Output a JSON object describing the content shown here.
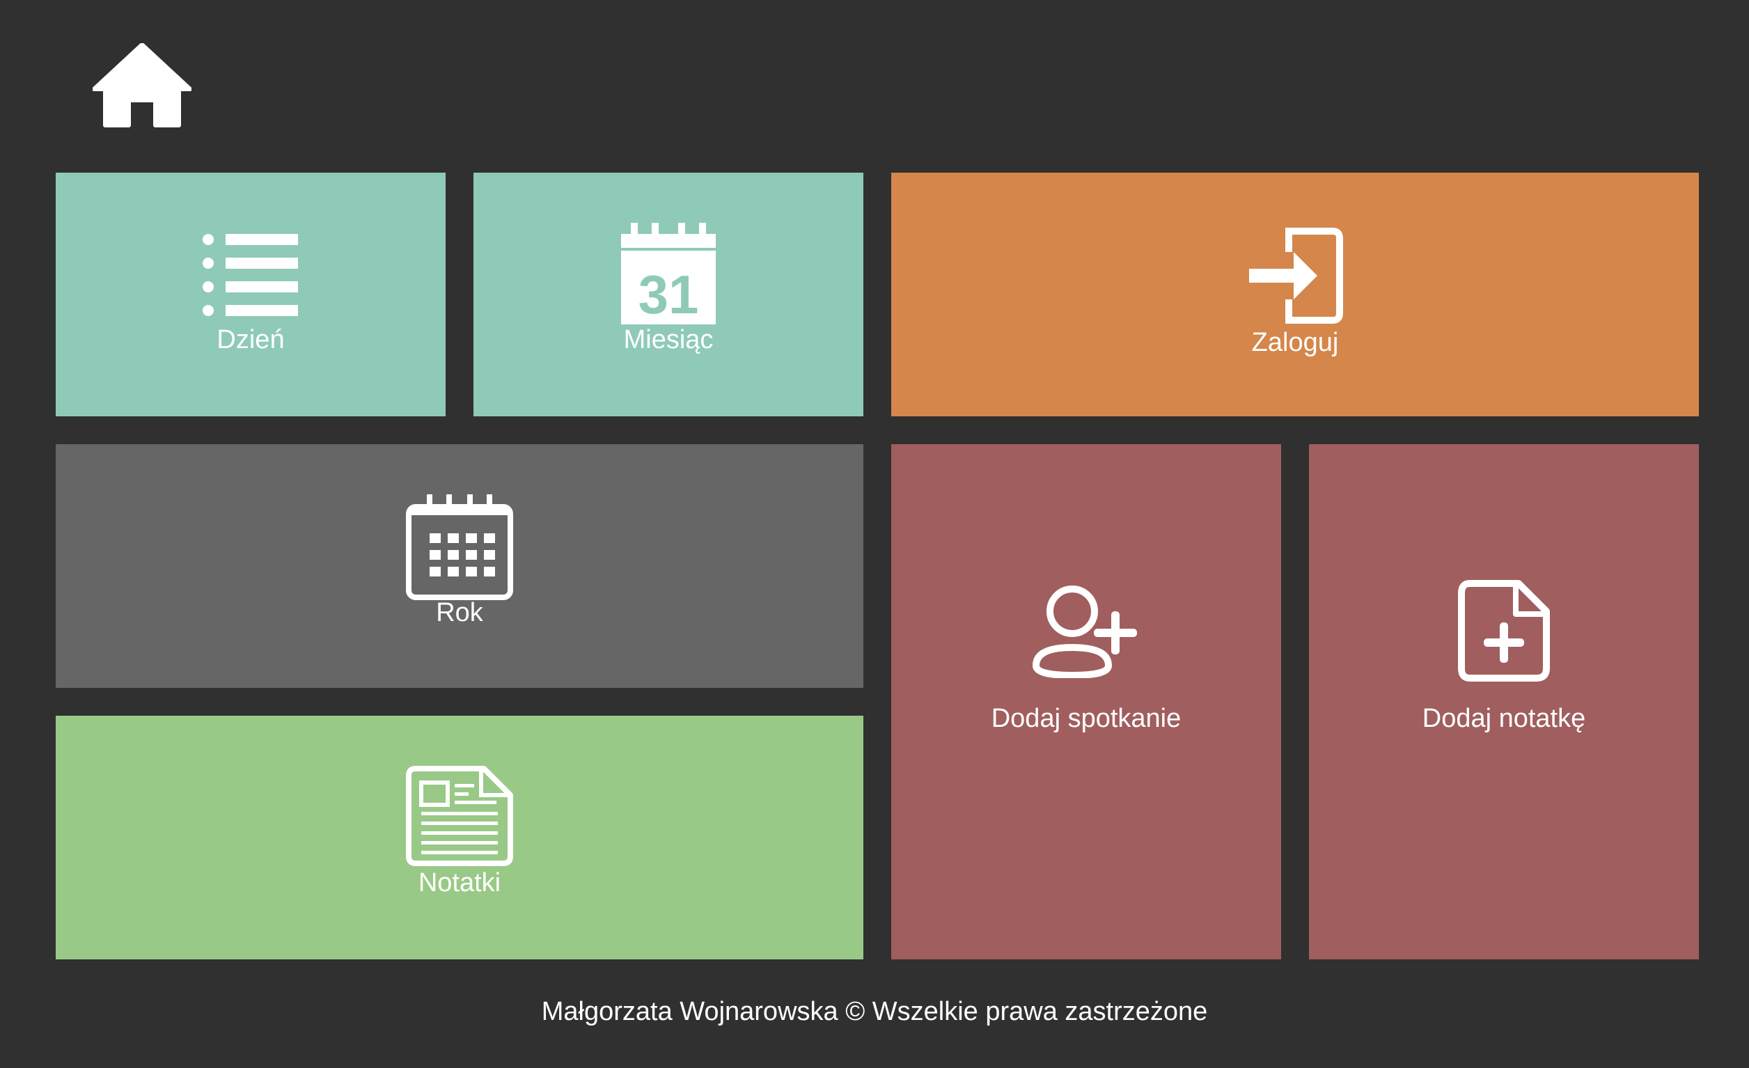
{
  "colors": {
    "background": "#303030",
    "teal": "#8fcab9",
    "orange": "#d5864a",
    "gray": "#666666",
    "green": "#99c987",
    "maroon": "#a05e5e",
    "text": "#ffffff"
  },
  "header": {
    "home_icon": "home-icon"
  },
  "tiles": {
    "day": {
      "label": "Dzień",
      "icon": "list-icon",
      "color": "#8fcab9"
    },
    "month": {
      "label": "Miesiąc",
      "icon": "calendar-31-icon",
      "calendar_day": "31",
      "color": "#8fcab9"
    },
    "login": {
      "label": "Zaloguj",
      "icon": "sign-in-icon",
      "color": "#d5864a"
    },
    "year": {
      "label": "Rok",
      "icon": "calendar-grid-icon",
      "color": "#666666"
    },
    "notes": {
      "label": "Notatki",
      "icon": "newspaper-icon",
      "color": "#99c987"
    },
    "add_meeting": {
      "label": "Dodaj spotkanie",
      "icon": "user-plus-icon",
      "color": "#a05e5e"
    },
    "add_note": {
      "label": "Dodaj notatkę",
      "icon": "file-plus-icon",
      "color": "#a05e5e"
    }
  },
  "footer": {
    "text": "Małgorzata Wojnarowska © Wszelkie prawa zastrzeżone"
  }
}
